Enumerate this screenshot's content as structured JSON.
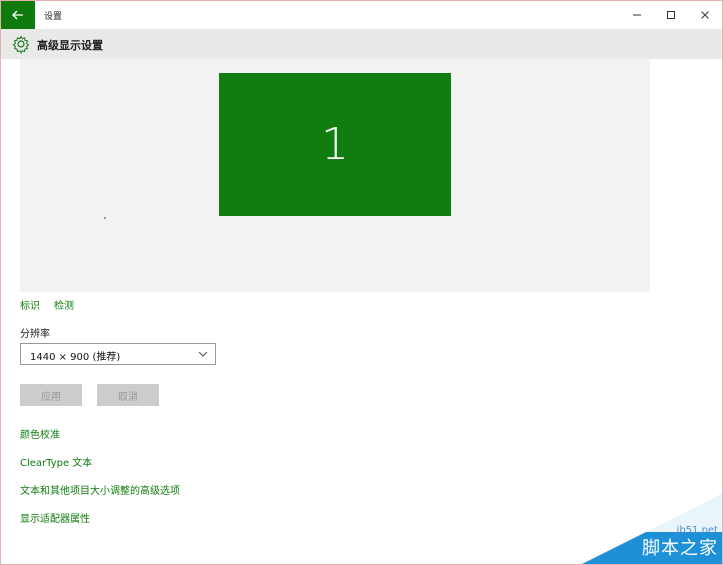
{
  "window": {
    "title": "设置",
    "controls": {
      "minimize": "−",
      "maximize": "☐",
      "close": "✕"
    }
  },
  "header": {
    "icon": "gear-icon",
    "title": "高级显示设置"
  },
  "display": {
    "monitor_number": "1",
    "monitor_color": "#117d11",
    "identify_label": "标识",
    "detect_label": "检测"
  },
  "resolution": {
    "label": "分辨率",
    "selected": "1440 × 900 (推荐)"
  },
  "buttons": {
    "apply": "应用",
    "cancel": "取消"
  },
  "options": [
    "颜色校准",
    "ClearType 文本",
    "文本和其他项目大小调整的高级选项",
    "显示适配器属性"
  ],
  "watermark": {
    "url": "jb51.net",
    "name": "脚本之家"
  },
  "colors": {
    "accent": "#0f7b0f",
    "header_bg": "#e9e9e9",
    "display_bg": "#f2f2f2",
    "disabled_btn": "#cccccc"
  }
}
